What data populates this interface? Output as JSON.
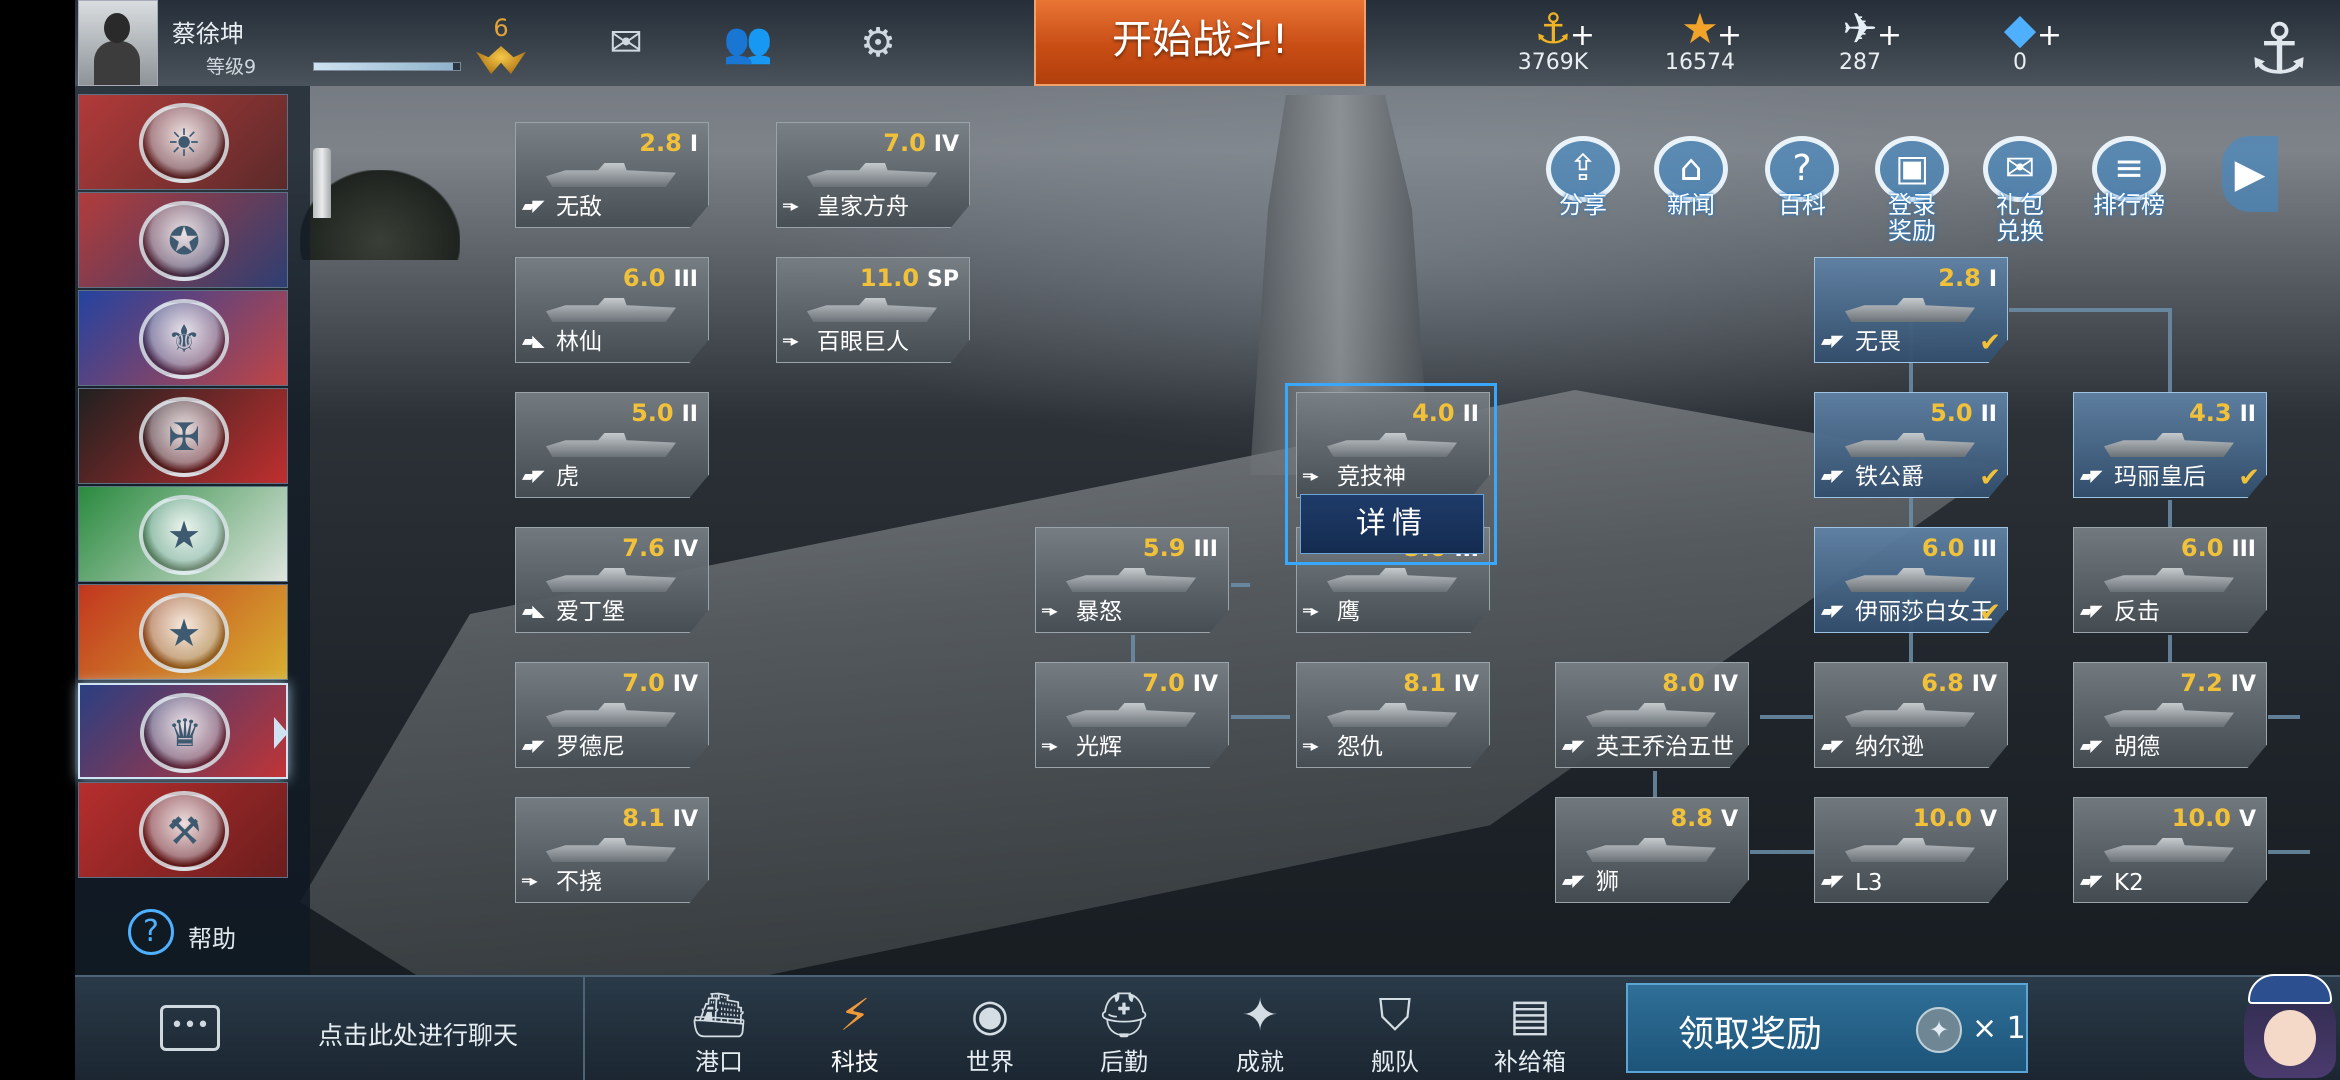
{
  "header": {
    "player_name": "蔡徐坤",
    "player_level": "等级9",
    "xp_progress": 0.95,
    "rank": "6",
    "start_battle": "开始战斗!",
    "resources": [
      {
        "name": "gold-coin-icon",
        "value": "3769K",
        "glyph": "⚓"
      },
      {
        "name": "star-icon",
        "value": "16574",
        "glyph": "★"
      },
      {
        "name": "wing-icon",
        "value": "287",
        "glyph": "✈"
      },
      {
        "name": "diamond-icon",
        "value": "0",
        "glyph": "◆"
      }
    ]
  },
  "nations": [
    {
      "id": "japan",
      "emblem": "☀",
      "colors": [
        "#b33a3a",
        "#5a2a2a"
      ]
    },
    {
      "id": "usa",
      "emblem": "✪",
      "colors": [
        "#b23b3b",
        "#2c3f73"
      ]
    },
    {
      "id": "france",
      "emblem": "⚜",
      "colors": [
        "#2443a0",
        "#c24444"
      ]
    },
    {
      "id": "germany",
      "emblem": "✠",
      "colors": [
        "#202020",
        "#c22f2f"
      ]
    },
    {
      "id": "italy",
      "emblem": "★",
      "colors": [
        "#2a8a3f",
        "#e0e6e0"
      ]
    },
    {
      "id": "china",
      "emblem": "★",
      "colors": [
        "#c2361f",
        "#d8b02f"
      ]
    },
    {
      "id": "uk",
      "emblem": "♛",
      "colors": [
        "#2a3f82",
        "#c43434"
      ],
      "active": true
    },
    {
      "id": "soviet",
      "emblem": "⚒",
      "colors": [
        "#b62e2e",
        "#6a1d1d"
      ]
    }
  ],
  "help_label": "帮助",
  "features": [
    {
      "label": "分享",
      "icon": "share-icon",
      "glyph": "⇪"
    },
    {
      "label": "新闻",
      "icon": "news-icon",
      "glyph": "⌂"
    },
    {
      "label": "百科",
      "icon": "encyclopedia-icon",
      "glyph": "?"
    },
    {
      "label": "登录\n奖励",
      "icon": "login-reward-icon",
      "glyph": "▣"
    },
    {
      "label": "礼包\n兑换",
      "icon": "gift-exchange-icon",
      "glyph": "✉"
    },
    {
      "label": "排行榜",
      "icon": "ranking-icon",
      "glyph": "≡"
    }
  ],
  "ships": [
    {
      "name": "无敌",
      "tier": "2.8",
      "roman": "I",
      "class": "▰◤",
      "owned": false
    },
    {
      "name": "皇家方舟",
      "tier": "7.0",
      "roman": "IV",
      "class": "═▸",
      "owned": false
    },
    {
      "name": "林仙",
      "tier": "6.0",
      "roman": "III",
      "class": "▰◣",
      "owned": false
    },
    {
      "name": "百眼巨人",
      "tier": "11.0",
      "roman": "SP",
      "class": "═▸",
      "owned": false
    },
    {
      "name": "虎",
      "tier": "5.0",
      "roman": "II",
      "class": "▰◤",
      "owned": false
    },
    {
      "name": "爱丁堡",
      "tier": "7.6",
      "roman": "IV",
      "class": "▰◣",
      "owned": false
    },
    {
      "name": "罗德尼",
      "tier": "7.0",
      "roman": "IV",
      "class": "▰◤",
      "owned": false
    },
    {
      "name": "不挠",
      "tier": "8.1",
      "roman": "IV",
      "class": "═▸",
      "owned": false
    },
    {
      "name": "暴怒",
      "tier": "5.9",
      "roman": "III",
      "class": "═▸",
      "owned": false
    },
    {
      "name": "光辉",
      "tier": "7.0",
      "roman": "IV",
      "class": "═▸",
      "owned": false
    },
    {
      "name": "竞技神",
      "tier": "4.0",
      "roman": "II",
      "class": "═▸",
      "owned": false
    },
    {
      "name": "鹰",
      "tier": "5.0",
      "roman": "III",
      "class": "═▸",
      "owned": false
    },
    {
      "name": "怨仇",
      "tier": "8.1",
      "roman": "IV",
      "class": "═▸",
      "owned": false
    },
    {
      "name": "英王乔治五世",
      "tier": "8.0",
      "roman": "IV",
      "class": "▰◤",
      "owned": false
    },
    {
      "name": "狮",
      "tier": "8.8",
      "roman": "V",
      "class": "▰◤",
      "owned": false
    },
    {
      "name": "无畏",
      "tier": "2.8",
      "roman": "I",
      "class": "▰◤",
      "owned": true
    },
    {
      "name": "铁公爵",
      "tier": "5.0",
      "roman": "II",
      "class": "▰◤",
      "owned": true
    },
    {
      "name": "伊丽莎白女王",
      "tier": "6.0",
      "roman": "III",
      "class": "▰◤",
      "owned": true
    },
    {
      "name": "纳尔逊",
      "tier": "6.8",
      "roman": "IV",
      "class": "▰◤",
      "owned": false
    },
    {
      "name": "L3",
      "tier": "10.0",
      "roman": "V",
      "class": "▰◤",
      "owned": false
    },
    {
      "name": "玛丽皇后",
      "tier": "4.3",
      "roman": "II",
      "class": "▰◤",
      "owned": true
    },
    {
      "name": "反击",
      "tier": "6.0",
      "roman": "III",
      "class": "▰◤",
      "owned": false
    },
    {
      "name": "胡德",
      "tier": "7.2",
      "roman": "IV",
      "class": "▰◤",
      "owned": false
    },
    {
      "name": "K2",
      "tier": "10.0",
      "roman": "V",
      "class": "▰◤",
      "owned": false
    }
  ],
  "details_button": "详情",
  "chat_placeholder": "点击此处进行聊天",
  "nav": [
    {
      "label": "港口",
      "icon": "harbor-icon",
      "glyph": "⛴",
      "active": false
    },
    {
      "label": "科技",
      "icon": "tech-icon",
      "glyph": "⚡",
      "active": true
    },
    {
      "label": "世界",
      "icon": "world-icon",
      "glyph": "◉",
      "active": false
    },
    {
      "label": "后勤",
      "icon": "logistics-icon",
      "glyph": "⛑",
      "active": false
    },
    {
      "label": "成就",
      "icon": "achievement-icon",
      "glyph": "✦",
      "active": false
    },
    {
      "label": "舰队",
      "icon": "fleet-icon",
      "glyph": "⛉",
      "active": false
    },
    {
      "label": "补给箱",
      "icon": "supply-box-icon",
      "glyph": "▤",
      "active": false
    }
  ],
  "claim_reward": {
    "label": "领取奖励",
    "count": "× 1"
  },
  "colors": {
    "accent_blue": "#3aa7ff",
    "battle_orange": "#d3561b",
    "tier_yellow": "#f2c13a"
  }
}
